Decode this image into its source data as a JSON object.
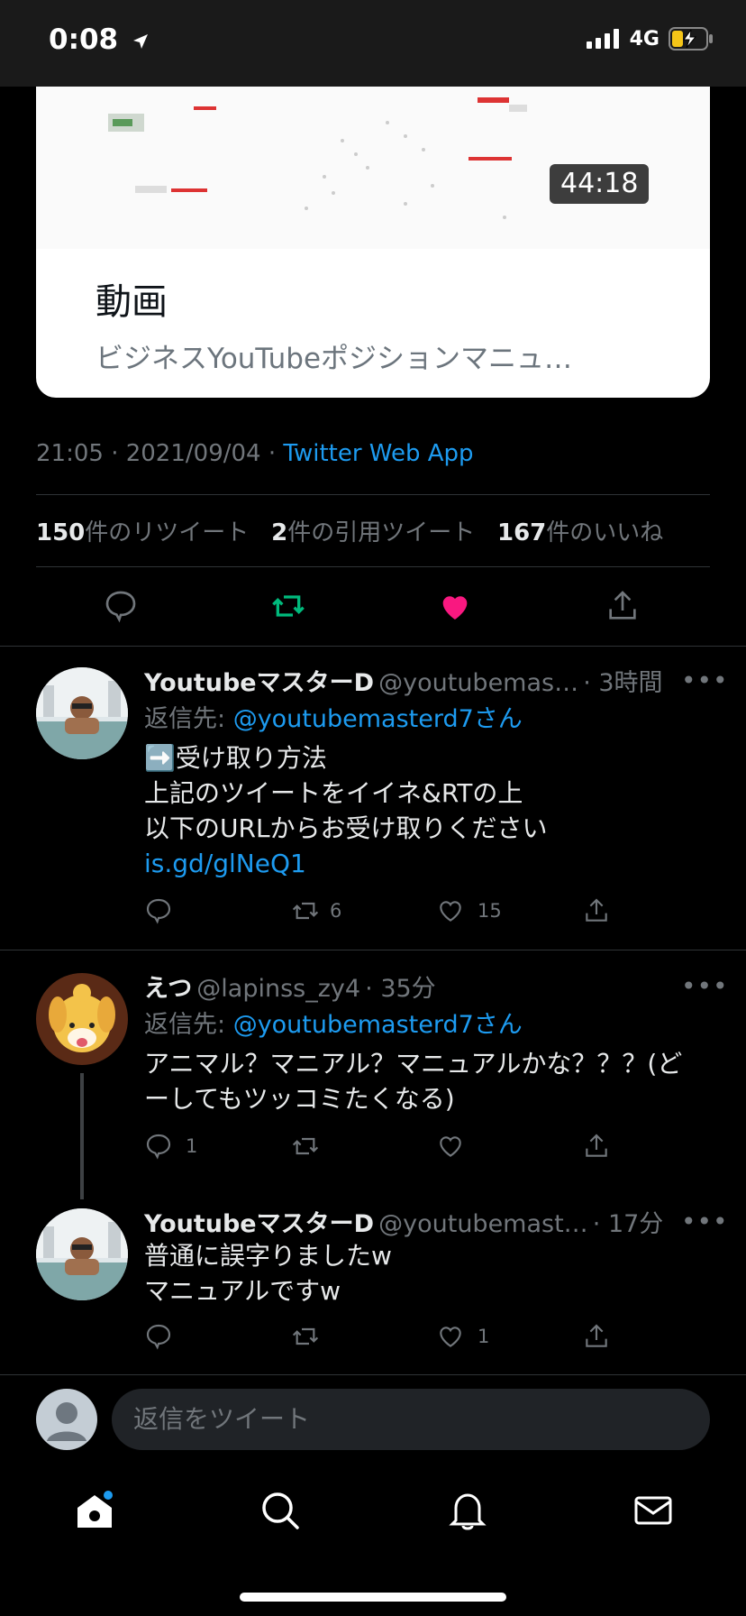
{
  "status": {
    "time": "0:08",
    "network": "4G"
  },
  "card": {
    "duration": "44:18",
    "kind": "動画",
    "description": "ビジネスYouTubeポジションマニュ…"
  },
  "tweet_meta": {
    "time": "21:05 · 2021/09/04 · ",
    "source": "Twitter Web App"
  },
  "stats": {
    "retweets_count": "150",
    "retweets_label": "件のリツイート",
    "quotes_count": "2",
    "quotes_label": "件の引用ツイート",
    "likes_count": "167",
    "likes_label": "件のいいね"
  },
  "replies": [
    {
      "name": "YoutubeマスターD",
      "handle": "@youtubemas…",
      "time": "· 3時間",
      "reply_to_label": "返信先: ",
      "reply_to": "@youtubemasterd7さん",
      "lines": [
        "➡️受け取り方法",
        "上記のツイートをイイネ&RTの上",
        "以下のURLからお受け取りください"
      ],
      "link": "is.gd/glNeQ1",
      "retweets": "6",
      "likes": "15"
    },
    {
      "name": "えつ",
      "handle": "@lapinss_zy4",
      "time": "· 35分",
      "reply_to_label": "返信先: ",
      "reply_to": "@youtubemasterd7さん",
      "lines": [
        "アニマル？マニアル？マニュアルかな？？？(ど",
        "ーしてもツッコミたくなる)"
      ],
      "comments": "1"
    },
    {
      "name": "YoutubeマスターD",
      "handle": "@youtubemast…",
      "time": "· 17分",
      "lines": [
        "普通に誤字りましたw",
        "マニュアルですw"
      ],
      "likes": "1"
    }
  ],
  "composer": {
    "placeholder": "返信をツイート"
  },
  "more_symbol": "•••",
  "colors": {
    "accent": "#1d9bf0",
    "retweet": "#00ba7c",
    "like": "#f91880",
    "background": "#000000"
  },
  "icons": [
    "location-arrow-icon",
    "signal-icon",
    "battery-icon",
    "reply-icon",
    "retweet-icon",
    "like-icon",
    "share-icon",
    "more-icon",
    "home-icon",
    "search-icon",
    "notifications-icon",
    "messages-icon",
    "avatar-placeholder-icon"
  ]
}
